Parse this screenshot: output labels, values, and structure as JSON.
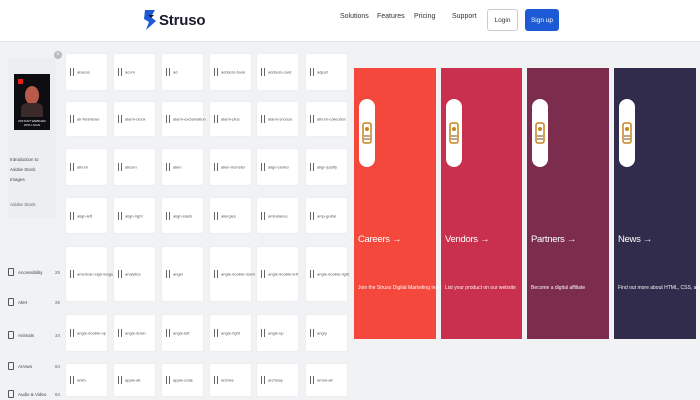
{
  "header": {
    "brand": "Struso",
    "nav": [
      "Solutions",
      "Features",
      "Pricing",
      "Support"
    ],
    "login_label": "Login",
    "signup_label": "Sign up"
  },
  "ad": {
    "close": "×",
    "thumb_caption": "INSTANT WEBINAR WITH JUAN",
    "description": "Introduction to Adobe Stock Images",
    "source": "Adobe Stock"
  },
  "sidebar": {
    "items": [
      {
        "label": "Accessibility",
        "count": "25"
      },
      {
        "label": "Alert",
        "count": "25"
      },
      {
        "label": "Animals",
        "count": "34"
      },
      {
        "label": "Arrows",
        "count": "84"
      },
      {
        "label": "Audio & Video",
        "count": "84"
      }
    ]
  },
  "icon_tiles": [
    "abacus",
    "acorn",
    "ad",
    "address-book",
    "address-card",
    "adjust",
    "air-freshener",
    "alarm-clock",
    "alarm-exclamation",
    "alarm-plus",
    "alarm-snooze",
    "album-collection",
    "album",
    "alicorn",
    "alien",
    "alien-monster",
    "align-center",
    "align-justify",
    "align-left",
    "align-right",
    "align-slash",
    "allergies",
    "ambulance",
    "amp-guitar",
    "american-sign-language-interpreting",
    "analytics",
    "angel",
    "angle-double-down",
    "angle-double-left",
    "angle-double-right",
    "angle-double-up",
    "angle-down",
    "angle-left",
    "angle-right",
    "angle-up",
    "angry",
    "ankh",
    "apple-alt",
    "apple-crate",
    "archive",
    "archway",
    "arrow-alt"
  ],
  "cards": [
    {
      "title": "Careers →",
      "description": "Join the Struso Digital Marketing team today",
      "color": "#f4483d"
    },
    {
      "title": "Vendors →",
      "description": "List your product on our website",
      "color": "#c8304e"
    },
    {
      "title": "Partners →",
      "description": "Become a digital affiliate",
      "color": "#7c2d4e"
    },
    {
      "title": "News →",
      "description": "Find out more about HTML, CSS, and more",
      "color": "#322c4c"
    }
  ]
}
